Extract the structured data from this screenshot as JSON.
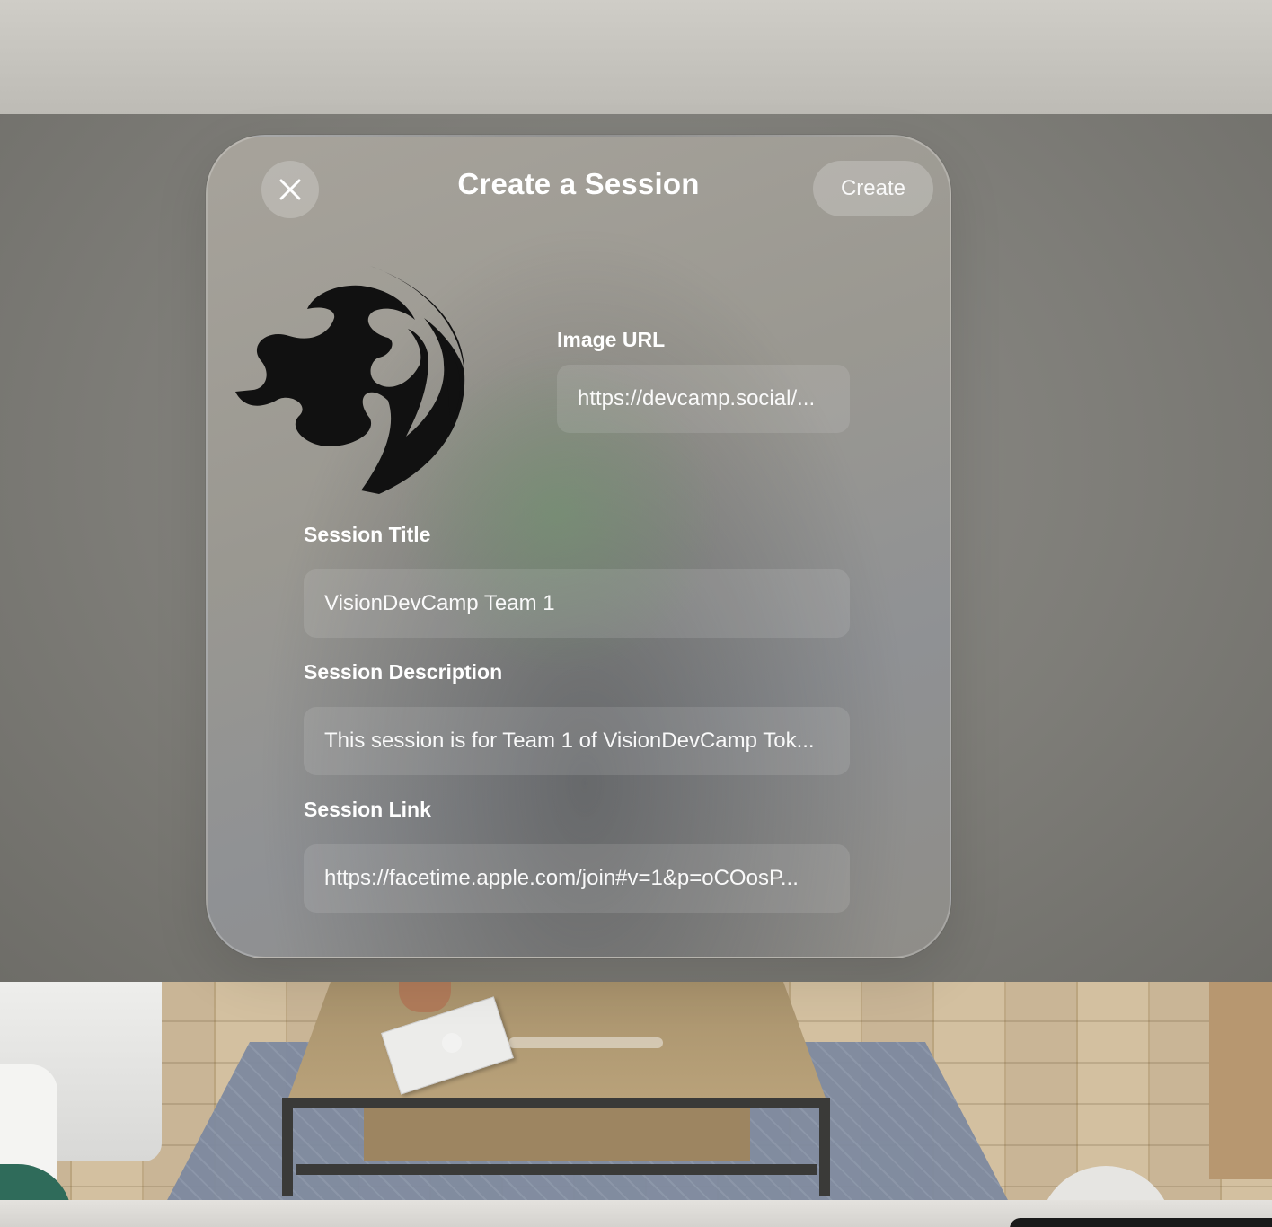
{
  "header": {
    "title": "Create a Session",
    "create_label": "Create"
  },
  "icons": {
    "close": "close-icon",
    "avatar": "session-avatar-image"
  },
  "form": {
    "image_url": {
      "label": "Image URL",
      "value": "https://devcamp.social/..."
    },
    "session_title": {
      "label": "Session Title",
      "value": "VisionDevCamp Team 1"
    },
    "session_description": {
      "label": "Session Description",
      "value": "This session is for Team 1 of VisionDevCamp Tok..."
    },
    "session_link": {
      "label": "Session Link",
      "value": "https://facetime.apple.com/join#v=1&p=oCOosP..."
    }
  },
  "colors": {
    "glass": "#9a9891",
    "text": "#ffffff",
    "avatar_fill": "#111111"
  }
}
